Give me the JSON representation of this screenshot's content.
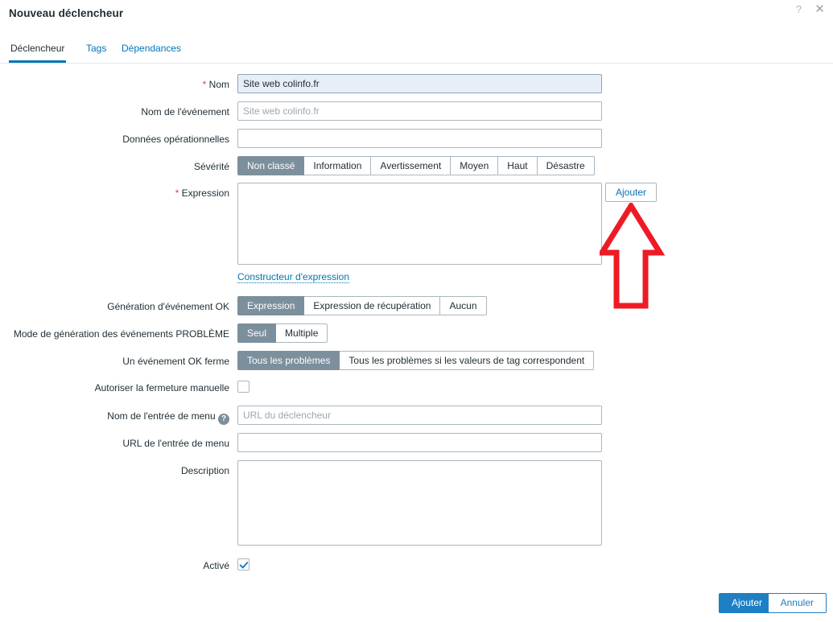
{
  "dialog": {
    "title": "Nouveau déclencheur",
    "help_icon": "?",
    "close_icon": "✕"
  },
  "tabs": [
    {
      "label": "Déclencheur",
      "active": true
    },
    {
      "label": "Tags",
      "active": false
    },
    {
      "label": "Dépendances",
      "active": false
    }
  ],
  "form": {
    "name": {
      "label": "Nom",
      "required": "*",
      "value": "Site web colinfo.fr",
      "placeholder": ""
    },
    "event_name": {
      "label": "Nom de l'événement",
      "value": "",
      "placeholder": "Site web colinfo.fr"
    },
    "operational_data": {
      "label": "Données opérationnelles",
      "value": "",
      "placeholder": ""
    },
    "severity": {
      "label": "Sévérité",
      "options": [
        "Non classé",
        "Information",
        "Avertissement",
        "Moyen",
        "Haut",
        "Désastre"
      ],
      "selected": "Non classé"
    },
    "expression": {
      "label": "Expression",
      "required": "*",
      "value": "",
      "add_button": "Ajouter",
      "constructor_link": "Constructeur d'expression"
    },
    "ok_event_generation": {
      "label": "Génération d'événement OK",
      "options": [
        "Expression",
        "Expression de récupération",
        "Aucun"
      ],
      "selected": "Expression"
    },
    "problem_event_mode": {
      "label": "Mode de génération des événements PROBLÈME",
      "options": [
        "Seul",
        "Multiple"
      ],
      "selected": "Seul"
    },
    "ok_event_closes": {
      "label": "Un événement OK ferme",
      "options": [
        "Tous les problèmes",
        "Tous les problèmes si les valeurs de tag correspondent"
      ],
      "selected": "Tous les problèmes"
    },
    "allow_manual_close": {
      "label": "Autoriser la fermeture manuelle",
      "checked": false
    },
    "menu_entry_name": {
      "label": "Nom de l'entrée de menu",
      "help_icon": "?",
      "value": "",
      "placeholder": "URL du déclencheur"
    },
    "menu_entry_url": {
      "label": "URL de l'entrée de menu",
      "value": "",
      "placeholder": ""
    },
    "description": {
      "label": "Description",
      "value": "",
      "placeholder": ""
    },
    "enabled": {
      "label": "Activé",
      "checked": true
    }
  },
  "footer": {
    "submit": "Ajouter",
    "cancel": "Annuler"
  },
  "annotation": {
    "type": "up-arrow",
    "color": "#ee1b24"
  },
  "colors": {
    "accent": "#0275b8",
    "primary_button": "#1f7fc4",
    "segment_selected": "#7c8f9c",
    "focused_field": "#e8eef8",
    "required_asterisk": "#d64b4b",
    "annotation_red": "#ee1b24"
  }
}
